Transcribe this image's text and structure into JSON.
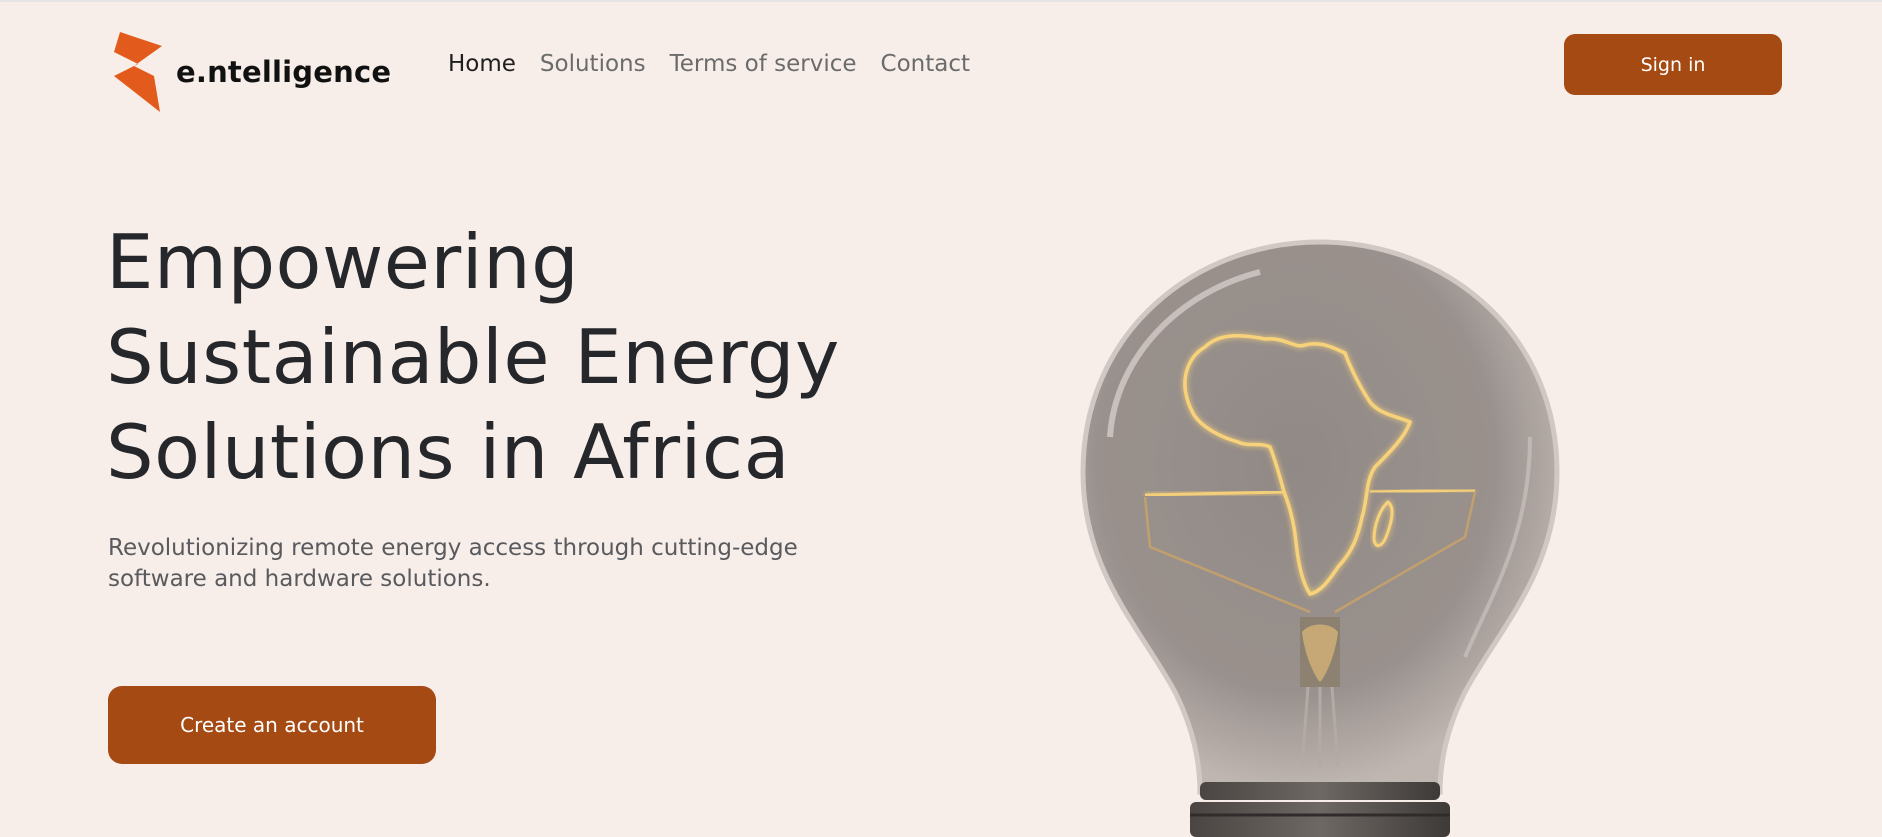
{
  "brand": {
    "name": "e.ntelligence",
    "accent_color": "#e35b1c",
    "logo_icon": "lightning-bolt-icon"
  },
  "nav": {
    "items": [
      {
        "label": "Home",
        "active": true
      },
      {
        "label": "Solutions",
        "active": false
      },
      {
        "label": "Terms of service",
        "active": false
      },
      {
        "label": "Contact",
        "active": false
      }
    ]
  },
  "header": {
    "sign_in_label": "Sign in"
  },
  "hero": {
    "title_lines": [
      "Empowering",
      "Sustainable Energy",
      "Solutions in Africa"
    ],
    "subtitle_lines": [
      "Revolutionizing remote energy access through cutting-edge",
      "software and hardware solutions."
    ],
    "cta_label": "Create an account",
    "image": "light-bulb-africa-filament"
  },
  "colors": {
    "background": "#f7eee9",
    "button": "#a54a13",
    "text_dark": "#25272b",
    "text_muted": "#6b6b6b"
  }
}
